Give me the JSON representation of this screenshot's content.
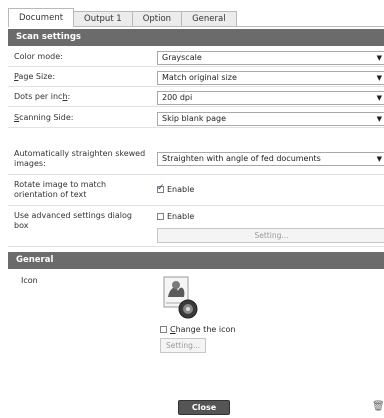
{
  "tabs": [
    "Document",
    "Output 1",
    "Option",
    "General"
  ],
  "scan_settings": {
    "header": "Scan settings",
    "color_mode": {
      "label": "Color mode:",
      "value": "Grayscale"
    },
    "page_size": {
      "label_first": "P",
      "label_rest": "age Size:",
      "value": "Match original size"
    },
    "dpi": {
      "label_pre": "Dots per inc",
      "label_u": "h",
      "label_post": ":",
      "value": "200 dpi"
    },
    "scanning_side": {
      "label_first": "S",
      "label_rest": "canning Side:",
      "value": "Skip blank page"
    },
    "straighten": {
      "label": "Automatically straighten skewed images:",
      "value": "Straighten with angle of fed documents"
    },
    "rotate": {
      "label": "Rotate image to match orientation of text",
      "checkbox": "Enable",
      "checked": true
    },
    "advanced": {
      "label": "Use advanced settings dialog box",
      "checkbox": "Enable",
      "checked": false,
      "button": "Setting..."
    }
  },
  "general": {
    "header": "General",
    "icon_label": "Icon",
    "change_icon_first": "C",
    "change_icon_rest": "hange the icon",
    "change_icon_checked": false,
    "setting_button": "Setting..."
  },
  "footer": {
    "close": "Close",
    "delete_icon": "trash-icon"
  }
}
